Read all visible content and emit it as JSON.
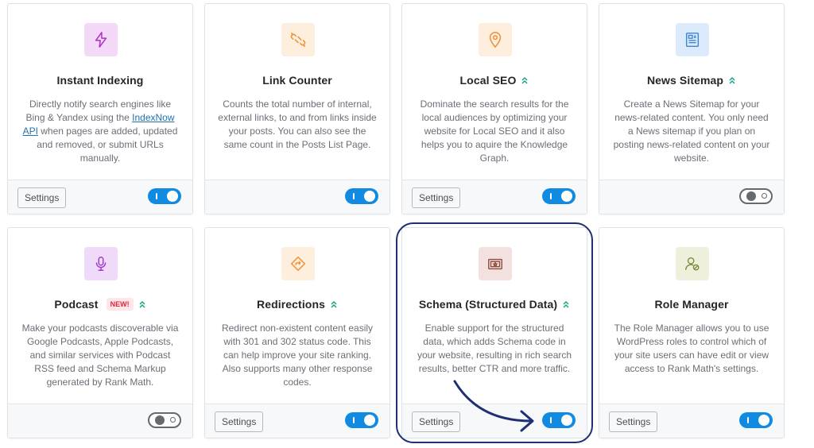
{
  "modules": [
    {
      "title": "Instant Indexing",
      "desc_before": "Directly notify search engines like Bing & Yandex using the ",
      "desc_link": "IndexNow API",
      "desc_after": " when pages are added, updated and removed, or submit URLs manually.",
      "settings_label": "Settings",
      "icon": "lightning-icon",
      "icon_color": "#b12bc8",
      "icon_bg": "#f3d8f7",
      "pro": false,
      "badge": "",
      "toggle_on": true
    },
    {
      "title": "Link Counter",
      "desc": "Counts the total number of internal, external links, to and from links inside your posts. You can also see the same count in the Posts List Page.",
      "settings_label": "",
      "icon": "broken-link-icon",
      "icon_color": "#ef8d2f",
      "icon_bg": "#fdeedd",
      "pro": false,
      "badge": "",
      "toggle_on": true
    },
    {
      "title": "Local SEO",
      "desc": "Dominate the search results for the local audiences by optimizing your website for Local SEO and it also helps you to aquire the Knowledge Graph.",
      "settings_label": "Settings",
      "icon": "map-pin-icon",
      "icon_color": "#ef8d2f",
      "icon_bg": "#fdeedd",
      "pro": true,
      "badge": "",
      "toggle_on": true
    },
    {
      "title": "News Sitemap",
      "desc": "Create a News Sitemap for your news-related content. You only need a News sitemap if you plan on posting news-related content on your website.",
      "settings_label": "",
      "icon": "newspaper-icon",
      "icon_color": "#3d86d6",
      "icon_bg": "#dcebfb",
      "pro": true,
      "badge": "",
      "toggle_on": false
    },
    {
      "title": "Podcast",
      "desc": "Make your podcasts discoverable via Google Podcasts, Apple Podcasts, and similar services with Podcast RSS feed and Schema Markup generated by Rank Math.",
      "settings_label": "",
      "icon": "microphone-icon",
      "icon_color": "#a13bd1",
      "icon_bg": "#efdafa",
      "pro": true,
      "badge": "NEW!",
      "toggle_on": false
    },
    {
      "title": "Redirections",
      "desc": "Redirect non-existent content easily with 301 and 302 status code. This can help improve your site ranking. Also supports many other response codes.",
      "settings_label": "Settings",
      "icon": "redirect-sign-icon",
      "icon_color": "#ef8d2f",
      "icon_bg": "#fdeedd",
      "pro": true,
      "badge": "",
      "toggle_on": true
    },
    {
      "title": "Schema (Structured Data)",
      "desc": "Enable support for the structured data, which adds Schema code in your website, resulting in rich search results, better CTR and more traffic.",
      "settings_label": "Settings",
      "icon": "schema-certificate-icon",
      "icon_color": "#8c4b3e",
      "icon_bg": "#f3e1df",
      "pro": true,
      "badge": "",
      "toggle_on": true
    },
    {
      "title": "Role Manager",
      "desc": "The Role Manager allows you to use WordPress roles to control which of your site users can have edit or view access to Rank Math's settings.",
      "settings_label": "Settings",
      "icon": "user-role-icon",
      "icon_color": "#7c8a3c",
      "icon_bg": "#eef0dc",
      "pro": false,
      "badge": "",
      "toggle_on": true
    }
  ],
  "colors": {
    "accent": "#108be1",
    "pro_chevron": "#19a58a",
    "highlight": "#1f2f73"
  }
}
